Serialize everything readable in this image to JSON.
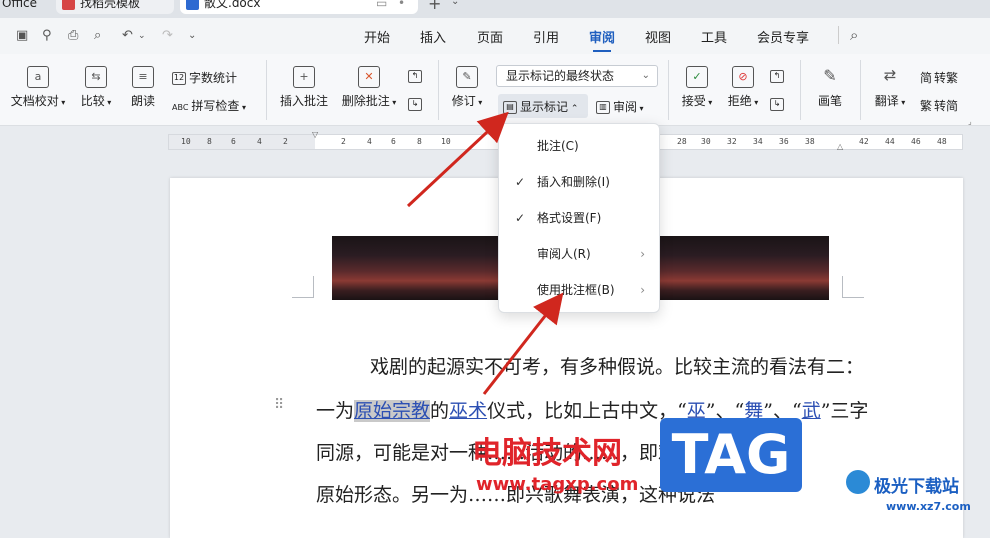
{
  "tabs": [
    {
      "label": "Office",
      "active": false
    },
    {
      "label": "找稻壳模板",
      "active": false
    },
    {
      "label": "散文.docx",
      "active": true
    }
  ],
  "menu_tabs": [
    "开始",
    "插入",
    "页面",
    "引用",
    "审阅",
    "视图",
    "工具",
    "会员专享"
  ],
  "active_menu": "审阅",
  "ribbon": {
    "doc_check": "文档校对",
    "compare": "比较",
    "read_aloud": "朗读",
    "word_count": "字数统计",
    "spell_check": "拼写检查",
    "insert_comment": "插入批注",
    "delete_comment": "删除批注",
    "revise": "修订",
    "display_state": "显示标记的最终状态",
    "show_markup": "显示标记",
    "review": "审阅",
    "accept": "接受",
    "reject": "拒绝",
    "pen": "画笔",
    "translate": "翻译",
    "to_traditional": "繁转简",
    "trad": "简转繁",
    "trad_short": "转繁",
    "simp_short": "转简"
  },
  "ruler_ticks": [
    "10",
    "8",
    "6",
    "4",
    "2",
    "2",
    "4",
    "6",
    "8",
    "10",
    "28",
    "30",
    "32",
    "34",
    "36",
    "38",
    "42",
    "44",
    "46",
    "48"
  ],
  "dropdown": [
    {
      "label": "批注(C)",
      "checked": false,
      "submenu": false
    },
    {
      "label": "插入和删除(I)",
      "checked": true,
      "submenu": false
    },
    {
      "label": "格式设置(F)",
      "checked": true,
      "submenu": false
    },
    {
      "label": "审阅人(R)",
      "checked": false,
      "submenu": true
    },
    {
      "label": "使用批注框(B)",
      "checked": false,
      "submenu": true
    }
  ],
  "document": {
    "line1": "戏剧的起源实不可考，有多种假说。比较主流的看法有二：",
    "line2_a": "一为",
    "line2_link1": "原始宗教",
    "line2_b": "的",
    "line2_link2": "巫术",
    "line2_c": "仪式，比如上古中文，“",
    "line2_link3": "巫",
    "line2_d": "”、“",
    "line2_link4": "舞",
    "line2_e": "”、“",
    "line2_link5": "武",
    "line2_f": "”三字",
    "line3": "同源，可能是对一种……活动的……，即戏剧的",
    "line4": "原始形态。另一为……即兴歌舞表演，这种说法"
  },
  "watermarks": {
    "cn": "电脑技术网",
    "url": "www.tagxp.com",
    "tag": "TAG",
    "site": "极光下载站",
    "site_url": "www.xz7.com"
  },
  "colors": {
    "accent": "#1f5fbf",
    "arrow": "#d0271e",
    "link": "#2c4fb3"
  }
}
